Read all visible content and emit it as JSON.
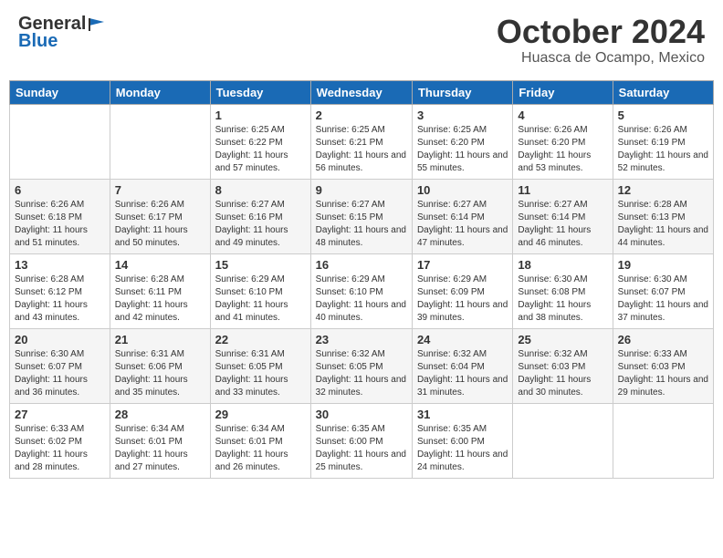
{
  "header": {
    "logo": {
      "general": "General",
      "blue": "Blue"
    },
    "title": "October 2024",
    "location": "Huasca de Ocampo, Mexico"
  },
  "weekdays": [
    "Sunday",
    "Monday",
    "Tuesday",
    "Wednesday",
    "Thursday",
    "Friday",
    "Saturday"
  ],
  "weeks": [
    [
      {
        "day": "",
        "info": ""
      },
      {
        "day": "",
        "info": ""
      },
      {
        "day": "1",
        "info": "Sunrise: 6:25 AM\nSunset: 6:22 PM\nDaylight: 11 hours and 57 minutes."
      },
      {
        "day": "2",
        "info": "Sunrise: 6:25 AM\nSunset: 6:21 PM\nDaylight: 11 hours and 56 minutes."
      },
      {
        "day": "3",
        "info": "Sunrise: 6:25 AM\nSunset: 6:20 PM\nDaylight: 11 hours and 55 minutes."
      },
      {
        "day": "4",
        "info": "Sunrise: 6:26 AM\nSunset: 6:20 PM\nDaylight: 11 hours and 53 minutes."
      },
      {
        "day": "5",
        "info": "Sunrise: 6:26 AM\nSunset: 6:19 PM\nDaylight: 11 hours and 52 minutes."
      }
    ],
    [
      {
        "day": "6",
        "info": "Sunrise: 6:26 AM\nSunset: 6:18 PM\nDaylight: 11 hours and 51 minutes."
      },
      {
        "day": "7",
        "info": "Sunrise: 6:26 AM\nSunset: 6:17 PM\nDaylight: 11 hours and 50 minutes."
      },
      {
        "day": "8",
        "info": "Sunrise: 6:27 AM\nSunset: 6:16 PM\nDaylight: 11 hours and 49 minutes."
      },
      {
        "day": "9",
        "info": "Sunrise: 6:27 AM\nSunset: 6:15 PM\nDaylight: 11 hours and 48 minutes."
      },
      {
        "day": "10",
        "info": "Sunrise: 6:27 AM\nSunset: 6:14 PM\nDaylight: 11 hours and 47 minutes."
      },
      {
        "day": "11",
        "info": "Sunrise: 6:27 AM\nSunset: 6:14 PM\nDaylight: 11 hours and 46 minutes."
      },
      {
        "day": "12",
        "info": "Sunrise: 6:28 AM\nSunset: 6:13 PM\nDaylight: 11 hours and 44 minutes."
      }
    ],
    [
      {
        "day": "13",
        "info": "Sunrise: 6:28 AM\nSunset: 6:12 PM\nDaylight: 11 hours and 43 minutes."
      },
      {
        "day": "14",
        "info": "Sunrise: 6:28 AM\nSunset: 6:11 PM\nDaylight: 11 hours and 42 minutes."
      },
      {
        "day": "15",
        "info": "Sunrise: 6:29 AM\nSunset: 6:10 PM\nDaylight: 11 hours and 41 minutes."
      },
      {
        "day": "16",
        "info": "Sunrise: 6:29 AM\nSunset: 6:10 PM\nDaylight: 11 hours and 40 minutes."
      },
      {
        "day": "17",
        "info": "Sunrise: 6:29 AM\nSunset: 6:09 PM\nDaylight: 11 hours and 39 minutes."
      },
      {
        "day": "18",
        "info": "Sunrise: 6:30 AM\nSunset: 6:08 PM\nDaylight: 11 hours and 38 minutes."
      },
      {
        "day": "19",
        "info": "Sunrise: 6:30 AM\nSunset: 6:07 PM\nDaylight: 11 hours and 37 minutes."
      }
    ],
    [
      {
        "day": "20",
        "info": "Sunrise: 6:30 AM\nSunset: 6:07 PM\nDaylight: 11 hours and 36 minutes."
      },
      {
        "day": "21",
        "info": "Sunrise: 6:31 AM\nSunset: 6:06 PM\nDaylight: 11 hours and 35 minutes."
      },
      {
        "day": "22",
        "info": "Sunrise: 6:31 AM\nSunset: 6:05 PM\nDaylight: 11 hours and 33 minutes."
      },
      {
        "day": "23",
        "info": "Sunrise: 6:32 AM\nSunset: 6:05 PM\nDaylight: 11 hours and 32 minutes."
      },
      {
        "day": "24",
        "info": "Sunrise: 6:32 AM\nSunset: 6:04 PM\nDaylight: 11 hours and 31 minutes."
      },
      {
        "day": "25",
        "info": "Sunrise: 6:32 AM\nSunset: 6:03 PM\nDaylight: 11 hours and 30 minutes."
      },
      {
        "day": "26",
        "info": "Sunrise: 6:33 AM\nSunset: 6:03 PM\nDaylight: 11 hours and 29 minutes."
      }
    ],
    [
      {
        "day": "27",
        "info": "Sunrise: 6:33 AM\nSunset: 6:02 PM\nDaylight: 11 hours and 28 minutes."
      },
      {
        "day": "28",
        "info": "Sunrise: 6:34 AM\nSunset: 6:01 PM\nDaylight: 11 hours and 27 minutes."
      },
      {
        "day": "29",
        "info": "Sunrise: 6:34 AM\nSunset: 6:01 PM\nDaylight: 11 hours and 26 minutes."
      },
      {
        "day": "30",
        "info": "Sunrise: 6:35 AM\nSunset: 6:00 PM\nDaylight: 11 hours and 25 minutes."
      },
      {
        "day": "31",
        "info": "Sunrise: 6:35 AM\nSunset: 6:00 PM\nDaylight: 11 hours and 24 minutes."
      },
      {
        "day": "",
        "info": ""
      },
      {
        "day": "",
        "info": ""
      }
    ]
  ]
}
